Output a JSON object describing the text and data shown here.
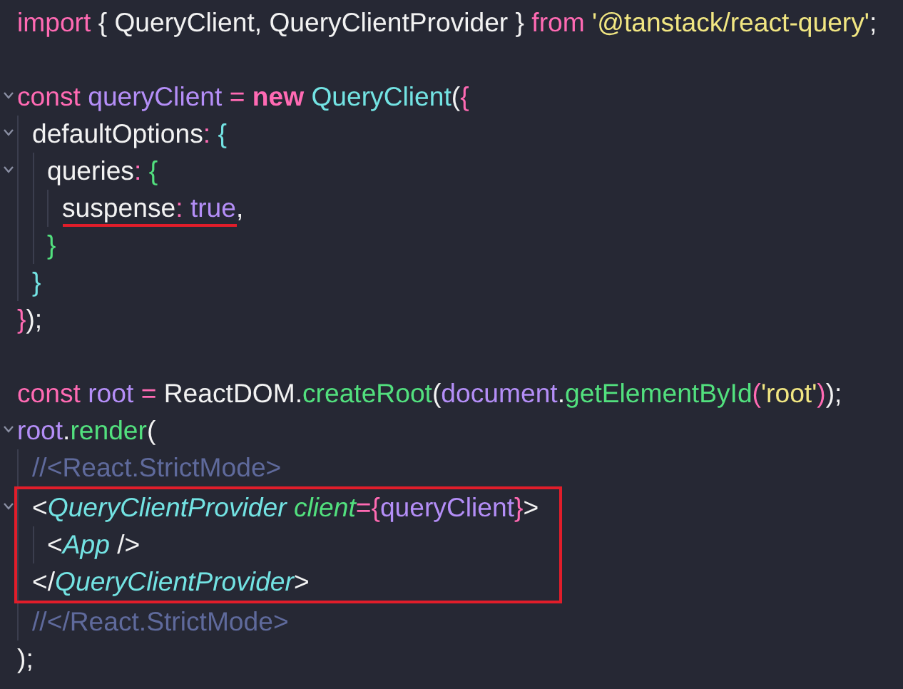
{
  "editor": {
    "lines": [
      {
        "kind": "code",
        "tokens": [
          {
            "text": "import",
            "kind": "keyword"
          },
          {
            "text": " { QueryClient, QueryClientProvider } ",
            "kind": "plain"
          },
          {
            "text": "from",
            "kind": "keyword"
          },
          {
            "text": " '@tanstack/react-query'",
            "kind": "string"
          },
          {
            "text": ";",
            "kind": "plain"
          }
        ]
      },
      {
        "kind": "blank"
      },
      {
        "kind": "code",
        "tokens": [
          {
            "text": "const",
            "kind": "keyword"
          },
          {
            "text": " queryClient",
            "kind": "variable"
          },
          {
            "text": " = ",
            "kind": "keyword"
          },
          {
            "text": "new",
            "kind": "keyword-strong"
          },
          {
            "text": " QueryClient",
            "kind": "class"
          },
          {
            "text": "(",
            "kind": "plain"
          },
          {
            "text": "{",
            "kind": "bracket-1"
          }
        ],
        "children": [
          {
            "kind": "code",
            "tokens": [
              {
                "text": "defaultOptions",
                "kind": "plain"
              },
              {
                "text": ": ",
                "kind": "keyword"
              },
              {
                "text": "{",
                "kind": "bracket-2"
              }
            ],
            "children": [
              {
                "kind": "code",
                "tokens": [
                  {
                    "text": "queries",
                    "kind": "plain"
                  },
                  {
                    "text": ": ",
                    "kind": "keyword"
                  },
                  {
                    "text": "{",
                    "kind": "bracket-3"
                  }
                ],
                "children": [
                  {
                    "kind": "code",
                    "tokens": [
                      {
                        "text": "suspense",
                        "kind": "plain",
                        "underlined": true
                      },
                      {
                        "text": ": ",
                        "kind": "keyword",
                        "underlined": true
                      },
                      {
                        "text": "true",
                        "kind": "variable",
                        "underlined": true
                      },
                      {
                        "text": ",",
                        "kind": "plain",
                        "underlined": false
                      }
                    ]
                  }
                ]
              },
              {
                "kind": "code",
                "tokens": [
                  {
                    "text": "}",
                    "kind": "bracket-3"
                  }
                ]
              }
            ]
          },
          {
            "kind": "code",
            "tokens": [
              {
                "text": "}",
                "kind": "bracket-2"
              }
            ]
          }
        ]
      },
      {
        "kind": "code",
        "tokens": [
          {
            "text": "}",
            "kind": "bracket-1"
          },
          {
            "text": ");",
            "kind": "plain"
          }
        ]
      },
      {
        "kind": "blank"
      },
      {
        "kind": "code",
        "tokens": [
          {
            "text": "const",
            "kind": "keyword"
          },
          {
            "text": " root",
            "kind": "variable"
          },
          {
            "text": " = ",
            "kind": "keyword"
          },
          {
            "text": "ReactDOM",
            "kind": "plain"
          },
          {
            "text": ".",
            "kind": "plain"
          },
          {
            "text": "createRoot",
            "kind": "function"
          },
          {
            "text": "(",
            "kind": "plain"
          },
          {
            "text": "document",
            "kind": "variable"
          },
          {
            "text": ".",
            "kind": "plain"
          },
          {
            "text": "getElementById",
            "kind": "function"
          },
          {
            "text": "(",
            "kind": "bracket-1"
          },
          {
            "text": "'root'",
            "kind": "string"
          },
          {
            "text": ")",
            "kind": "bracket-1"
          },
          {
            "text": ");",
            "kind": "plain"
          }
        ]
      },
      {
        "kind": "code",
        "tokens": [
          {
            "text": "root",
            "kind": "variable"
          },
          {
            "text": ".",
            "kind": "plain"
          },
          {
            "text": "render",
            "kind": "function"
          },
          {
            "text": "(",
            "kind": "plain"
          }
        ],
        "children": [
          {
            "kind": "code",
            "tokens": [
              {
                "text": "//<React.StrictMode>",
                "kind": "comment"
              }
            ]
          },
          {
            "kind": "code",
            "boxed": true,
            "tokens": [
              {
                "text": "<",
                "kind": "plain"
              },
              {
                "text": "QueryClientProvider",
                "kind": "tag"
              },
              {
                "text": " client",
                "kind": "attribute"
              },
              {
                "text": "=",
                "kind": "keyword"
              },
              {
                "text": "{",
                "kind": "bracket-1"
              },
              {
                "text": "queryClient",
                "kind": "variable"
              },
              {
                "text": "}",
                "kind": "bracket-1"
              },
              {
                "text": ">",
                "kind": "plain"
              }
            ],
            "children": [
              {
                "kind": "code",
                "tokens": [
                  {
                    "text": "<",
                    "kind": "plain"
                  },
                  {
                    "text": "App",
                    "kind": "tag"
                  },
                  {
                    "text": " />",
                    "kind": "plain"
                  }
                ]
              }
            ]
          },
          {
            "kind": "code",
            "boxed": true,
            "tokens": [
              {
                "text": "</",
                "kind": "plain"
              },
              {
                "text": "QueryClientProvider",
                "kind": "tag"
              },
              {
                "text": ">",
                "kind": "plain"
              }
            ]
          },
          {
            "kind": "code",
            "tokens": [
              {
                "text": "//</React.StrictMode>",
                "kind": "comment"
              }
            ]
          }
        ]
      },
      {
        "kind": "code",
        "tokens": [
          {
            "text": ");",
            "kind": "plain"
          }
        ]
      }
    ]
  }
}
